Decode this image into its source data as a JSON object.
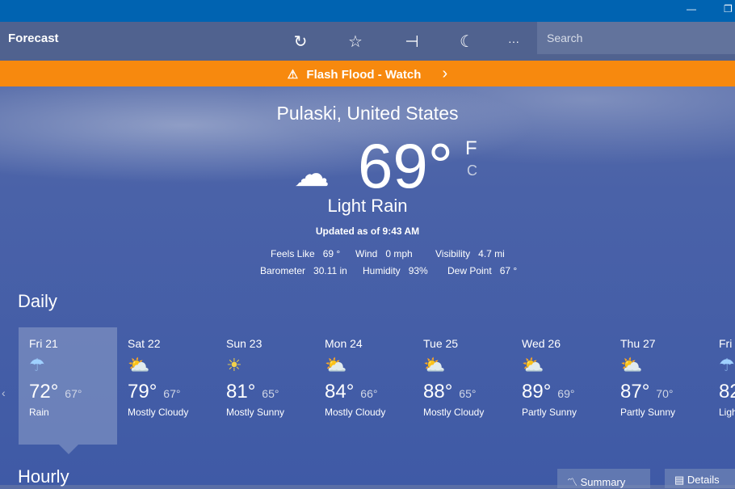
{
  "window": {
    "minimize": "—",
    "restore": "❐"
  },
  "appbar": {
    "title": "Forecast",
    "search_placeholder": "Search",
    "icons": [
      "refresh-icon",
      "star-icon",
      "pin-icon",
      "moon-icon",
      "more-icon"
    ],
    "refresh": "↻",
    "star": "☆",
    "pin": "⊣",
    "moon": "☾",
    "more": "···"
  },
  "alert": {
    "icon": "⚠",
    "text": "Flash Flood - Watch",
    "chevron": "›",
    "color": "#f7890e"
  },
  "current": {
    "location": "Pulaski, United States",
    "temp": "69°",
    "unit_f": "F",
    "unit_c": "C",
    "condition": "Light Rain",
    "icon": "☂",
    "updated": "Updated as of 9:43 AM",
    "details": [
      {
        "label": "Feels Like",
        "value": "69 °"
      },
      {
        "label": "Wind",
        "value": "0 mph"
      },
      {
        "label": "Visibility",
        "value": "4.7 mi"
      },
      {
        "label": "Barometer",
        "value": "30.11 in"
      },
      {
        "label": "Humidity",
        "value": "93%"
      },
      {
        "label": "Dew Point",
        "value": "67 °"
      }
    ]
  },
  "daily": {
    "title": "Daily",
    "days": [
      {
        "name": "Fri 21",
        "hi": "72°",
        "lo": "67°",
        "cond": "Rain",
        "icon": "rain"
      },
      {
        "name": "Sat 22",
        "hi": "79°",
        "lo": "67°",
        "cond": "Mostly Cloudy",
        "icon": "partly-cloudy"
      },
      {
        "name": "Sun 23",
        "hi": "81°",
        "lo": "65°",
        "cond": "Mostly Sunny",
        "icon": "sun"
      },
      {
        "name": "Mon 24",
        "hi": "84°",
        "lo": "66°",
        "cond": "Mostly Cloudy",
        "icon": "partly-cloudy"
      },
      {
        "name": "Tue 25",
        "hi": "88°",
        "lo": "65°",
        "cond": "Mostly Cloudy",
        "icon": "partly-cloudy"
      },
      {
        "name": "Wed 26",
        "hi": "89°",
        "lo": "69°",
        "cond": "Partly Sunny",
        "icon": "partly-cloudy"
      },
      {
        "name": "Thu 27",
        "hi": "87°",
        "lo": "70°",
        "cond": "Partly Sunny",
        "icon": "partly-cloudy"
      },
      {
        "name": "Fri",
        "hi": "82",
        "lo": "",
        "cond": "Ligh",
        "icon": "rain"
      }
    ]
  },
  "hourly": {
    "title": "Hourly",
    "summary": "Summary",
    "details": "Details"
  }
}
